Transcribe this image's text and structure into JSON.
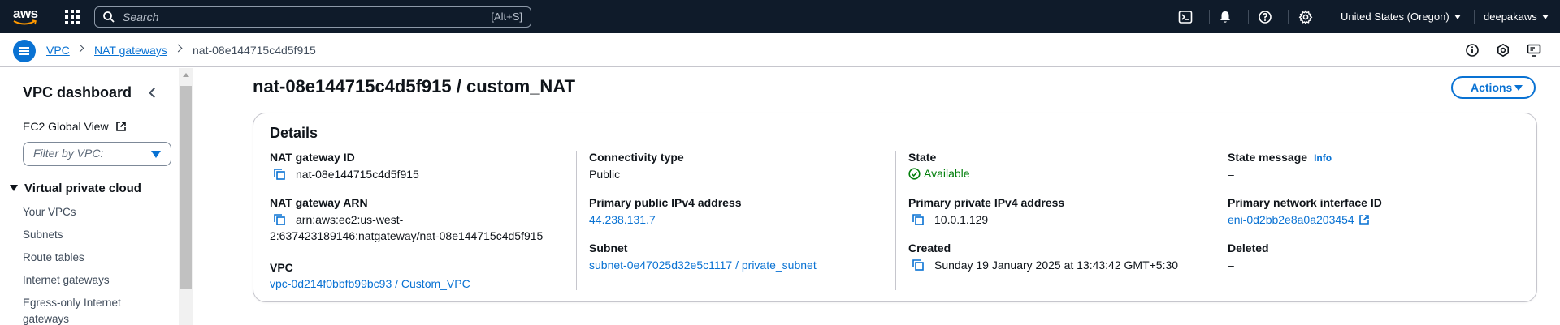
{
  "topnav": {
    "logo_text": "aws",
    "search_placeholder": "Search",
    "search_shortcut": "[Alt+S]",
    "region": "United States (Oregon)",
    "user": "deepakaws",
    "icons": [
      "cloudshell-icon",
      "bell-icon",
      "help-icon",
      "gear-icon"
    ]
  },
  "breadcrumb": {
    "items": [
      "VPC",
      "NAT gateways",
      "nat-08e144715c4d5f915"
    ]
  },
  "sidebar": {
    "title": "VPC dashboard",
    "ec2_global_view": "EC2 Global View",
    "filter_placeholder": "Filter by VPC:",
    "section": "Virtual private cloud",
    "items": [
      "Your VPCs",
      "Subnets",
      "Route tables",
      "Internet gateways",
      "Egress-only Internet",
      "gateways"
    ]
  },
  "main": {
    "title": "nat-08e144715c4d5f915 / custom_NAT",
    "actions_label": "Actions",
    "details_title": "Details",
    "col1": {
      "nat_id_label": "NAT gateway ID",
      "nat_id_value": "nat-08e144715c4d5f915",
      "arn_label": "NAT gateway ARN",
      "arn_line1": "arn:aws:ec2:us-west-",
      "arn_line2": "2:637423189146:natgateway/nat-08e144715c4d5f915",
      "vpc_label": "VPC",
      "vpc_value": "vpc-0d214f0bbfb99bc93 / Custom_VPC"
    },
    "col2": {
      "conn_label": "Connectivity type",
      "conn_value": "Public",
      "pub_ip_label": "Primary public IPv4 address",
      "pub_ip_value": "44.238.131.7",
      "subnet_label": "Subnet",
      "subnet_value": "subnet-0e47025d32e5c1117 / private_subnet"
    },
    "col3": {
      "state_label": "State",
      "state_value": "Available",
      "priv_ip_label": "Primary private IPv4 address",
      "priv_ip_value": "10.0.1.129",
      "created_label": "Created",
      "created_value": "Sunday 19 January 2025 at 13:43:42 GMT+5:30"
    },
    "col4": {
      "msg_label": "State message",
      "msg_info": "Info",
      "msg_value": "–",
      "eni_label": "Primary network interface ID",
      "eni_value": "eni-0d2bb2e8a0a203454",
      "deleted_label": "Deleted",
      "deleted_value": "–"
    }
  },
  "colors": {
    "nav_bg": "#0f1b2a",
    "link": "#0972d3",
    "success": "#037f0c",
    "border": "#c6c6cd"
  }
}
